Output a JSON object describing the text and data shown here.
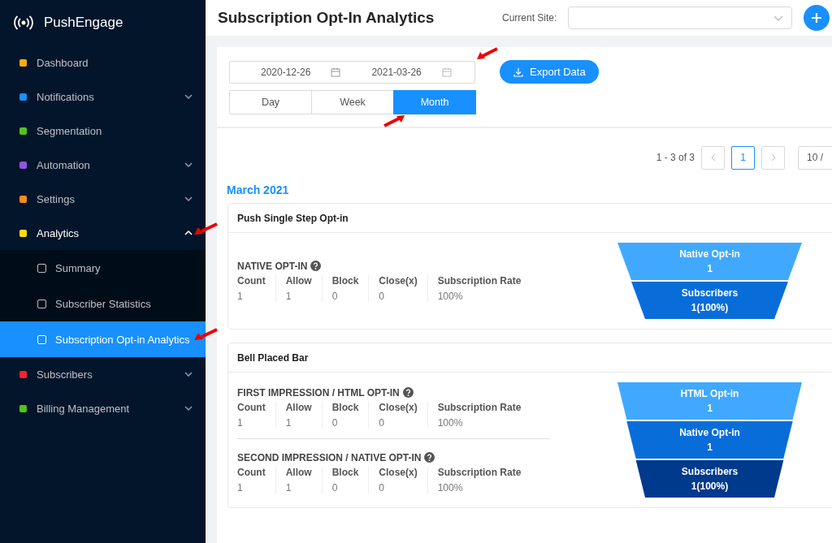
{
  "app": {
    "name": "PushEngage"
  },
  "sidebar": {
    "items": [
      {
        "label": "Dashboard",
        "kind": "link",
        "selected": false
      },
      {
        "label": "Notifications",
        "kind": "submenu",
        "selected": false,
        "expanded": false
      },
      {
        "label": "Segmentation",
        "kind": "link",
        "selected": false
      },
      {
        "label": "Automation",
        "kind": "submenu",
        "selected": false,
        "expanded": false
      },
      {
        "label": "Settings",
        "kind": "submenu",
        "selected": false,
        "expanded": false
      },
      {
        "label": "Analytics",
        "kind": "submenu",
        "selected": false,
        "expanded": true,
        "children": [
          {
            "label": "Summary",
            "selected": false
          },
          {
            "label": "Subscriber Statistics",
            "selected": false
          },
          {
            "label": "Subscription Opt-in Analytics",
            "selected": true
          }
        ]
      },
      {
        "label": "Subscribers",
        "kind": "submenu",
        "selected": false,
        "expanded": false
      },
      {
        "label": "Billing Management",
        "kind": "submenu",
        "selected": false,
        "expanded": false
      }
    ]
  },
  "header": {
    "title": "Subscription Opt-In Analytics",
    "site_label": "Current Site:"
  },
  "filters": {
    "start_date": "2020-12-26",
    "end_date": "2021-03-26",
    "export_button": "Export Data",
    "periods": [
      {
        "label": "Day",
        "selected": false
      },
      {
        "label": "Week",
        "selected": false
      },
      {
        "label": "Month",
        "selected": true
      }
    ]
  },
  "pagination": {
    "range": "1 - 3 of 3",
    "pages": [
      {
        "label": "1",
        "selected": true
      }
    ],
    "page_size": "10 /"
  },
  "month": "March 2021",
  "cards": [
    {
      "title": "Push Single Step Opt-in",
      "sections": [
        {
          "title": "NATIVE OPT-IN",
          "columns": [
            {
              "label": "Count",
              "value": "1"
            },
            {
              "label": "Allow",
              "value": "1"
            },
            {
              "label": "Block",
              "value": "0"
            },
            {
              "label": "Close(x)",
              "value": "0"
            },
            {
              "label": "Subscription Rate",
              "value": "100%"
            }
          ]
        }
      ],
      "funnel": [
        {
          "label": "Native Opt-in",
          "value": "1",
          "color": "#40a9ff"
        },
        {
          "label": "Subscribers",
          "value": "1(100%)",
          "color": "#096dd9"
        }
      ]
    },
    {
      "title": "Bell Placed Bar",
      "sections": [
        {
          "title": "FIRST IMPRESSION / HTML OPT-IN",
          "columns": [
            {
              "label": "Count",
              "value": "1"
            },
            {
              "label": "Allow",
              "value": "1"
            },
            {
              "label": "Block",
              "value": "0"
            },
            {
              "label": "Close(x)",
              "value": "0"
            },
            {
              "label": "Subscription Rate",
              "value": "100%"
            }
          ]
        },
        {
          "title": "SECOND IMPRESSION / NATIVE OPT-IN",
          "columns": [
            {
              "label": "Count",
              "value": "1"
            },
            {
              "label": "Allow",
              "value": "1"
            },
            {
              "label": "Block",
              "value": "0"
            },
            {
              "label": "Close(x)",
              "value": "0"
            },
            {
              "label": "Subscription Rate",
              "value": "100%"
            }
          ]
        }
      ],
      "funnel": [
        {
          "label": "HTML Opt-in",
          "value": "1",
          "color": "#40a9ff"
        },
        {
          "label": "Native Opt-in",
          "value": "1",
          "color": "#096dd9"
        },
        {
          "label": "Subscribers",
          "value": "1(100%)",
          "color": "#003a8c"
        }
      ]
    }
  ]
}
